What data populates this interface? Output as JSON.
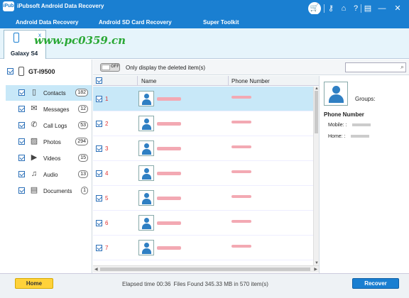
{
  "window": {
    "title": "iPubsoft Android Data Recovery",
    "logo_text": "iPub"
  },
  "tabs": [
    {
      "label": "Android Data Recovery"
    },
    {
      "label": "Android SD Card Recovery"
    },
    {
      "label": "Super Toolkit"
    }
  ],
  "toolbar": {
    "cart_icon": "cart-icon",
    "icons": [
      "key-icon",
      "home-icon",
      "help-icon",
      "register-icon",
      "minimize-icon",
      "close-icon"
    ],
    "glyphs": [
      "⚷",
      "⌂",
      "?",
      "▤",
      "—",
      "✕"
    ]
  },
  "watermark": "www.pc0359.cn",
  "device": {
    "tab_name": "Galaxy S4",
    "close_glyph": "x",
    "root_label": "GT-I9500"
  },
  "categories": [
    {
      "label": "Contacts",
      "count": "182",
      "icon": "contacts-icon",
      "glyph": "▯"
    },
    {
      "label": "Messages",
      "count": "12",
      "icon": "messages-icon",
      "glyph": "✉"
    },
    {
      "label": "Call Logs",
      "count": "53",
      "icon": "phone-icon",
      "glyph": "✆"
    },
    {
      "label": "Photos",
      "count": "294",
      "icon": "photos-icon",
      "glyph": "▨"
    },
    {
      "label": "Videos",
      "count": "15",
      "icon": "videos-icon",
      "glyph": "▶"
    },
    {
      "label": "Audio",
      "count": "13",
      "icon": "audio-icon",
      "glyph": "♫"
    },
    {
      "label": "Documents",
      "count": "1",
      "icon": "documents-icon",
      "glyph": "▤"
    }
  ],
  "filter": {
    "toggle_text": "OFF",
    "label": "Only display the deleted item(s)"
  },
  "list": {
    "headers": {
      "name": "Name",
      "phone": "Phone Number"
    },
    "rows": [
      {
        "index": "1"
      },
      {
        "index": "2"
      },
      {
        "index": "3"
      },
      {
        "index": "4"
      },
      {
        "index": "5"
      },
      {
        "index": "6"
      },
      {
        "index": "7"
      }
    ]
  },
  "detail": {
    "groups_label": "Groups:",
    "phone_title": "Phone Number",
    "mobile_label": "Mobile: :",
    "home_label": "Home: :"
  },
  "footer": {
    "home_label": "Home",
    "elapsed": "Elapsed time 00:36",
    "files_found": "Files Found 345.33 MB in 570 item(s)",
    "recover_label": "Recover"
  },
  "colors": {
    "accent": "#1a7fd1",
    "selected_row": "#c8e8f8",
    "home_button": "#ffd23a",
    "deleted_index": "#e0312f"
  }
}
